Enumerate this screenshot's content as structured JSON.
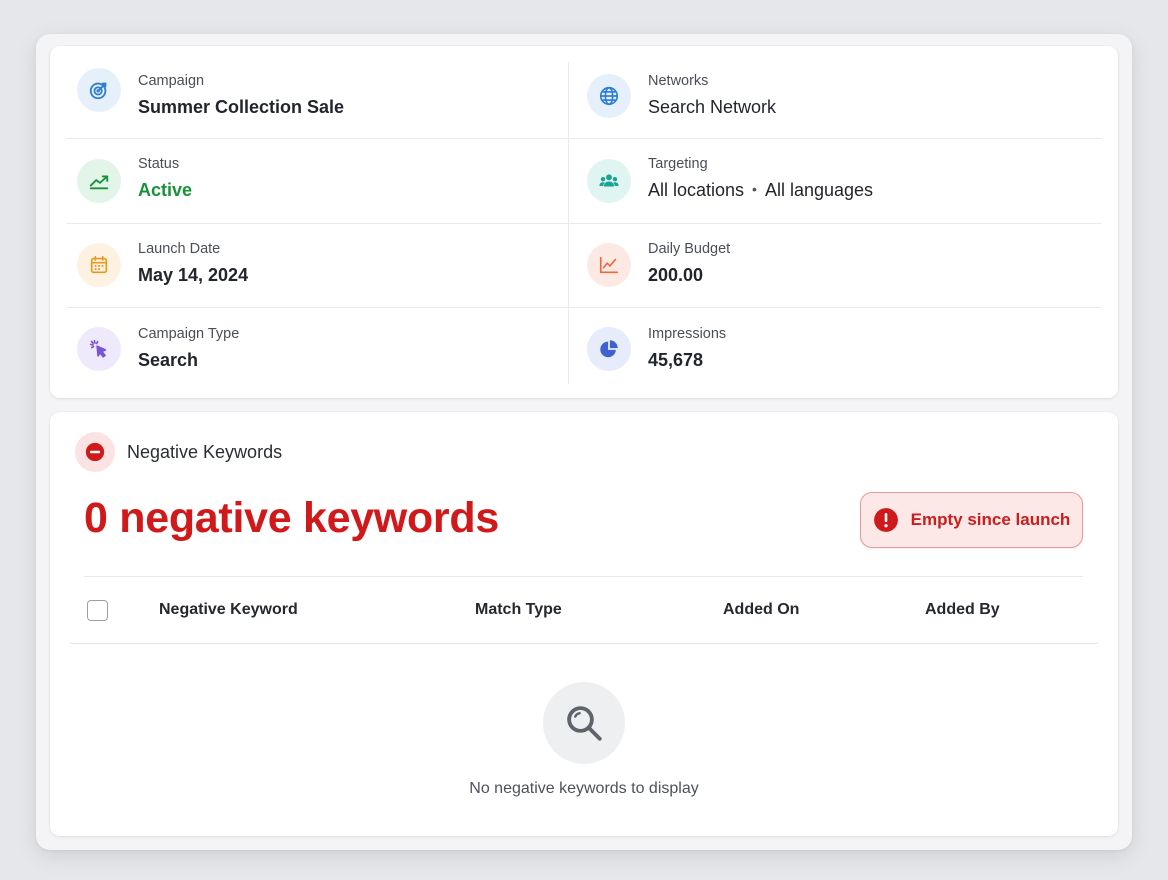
{
  "summary": {
    "campaign": {
      "label": "Campaign",
      "value": "Summer Collection Sale",
      "icon": "target-icon",
      "icon_bg": "#e6f0fb",
      "icon_color": "#2f7fd0"
    },
    "networks": {
      "label": "Networks",
      "value": "Search Network",
      "icon": "globe-icon",
      "icon_bg": "#e6f0fb",
      "icon_color": "#2f7fd0"
    },
    "status": {
      "label": "Status",
      "value": "Active",
      "icon": "trending-up-icon",
      "icon_bg": "#e3f4e8",
      "icon_color": "#17923a"
    },
    "targeting": {
      "label": "Targeting",
      "locations": "All locations",
      "separator": "•",
      "languages": "All languages",
      "icon": "people-icon",
      "icon_bg": "#e0f5f2",
      "icon_color": "#1aa392"
    },
    "launch_date": {
      "label": "Launch Date",
      "value": "May 14, 2024",
      "icon": "calendar-icon",
      "icon_bg": "#fdf2e1",
      "icon_color": "#e29a1f"
    },
    "daily_budget": {
      "label": "Daily Budget",
      "value": "200.00",
      "icon": "line-chart-icon",
      "icon_bg": "#fde9e3",
      "icon_color": "#ea6a3d"
    },
    "campaign_type": {
      "label": "Campaign Type",
      "value": "Search",
      "icon": "cursor-click-icon",
      "icon_bg": "#efeafb",
      "icon_color": "#7a54d6"
    },
    "impressions": {
      "label": "Impressions",
      "value": "45,678",
      "icon": "pie-chart-icon",
      "icon_bg": "#e6ecfa",
      "icon_color": "#3f62cf"
    }
  },
  "negative_keywords": {
    "title": "Negative Keywords",
    "count_text": "0 negative keywords",
    "warning": "Empty since launch",
    "columns": [
      "Negative Keyword",
      "Match Type",
      "Added On",
      "Added By"
    ],
    "empty_message": "No negative keywords to display",
    "accent": "#d0191b"
  }
}
